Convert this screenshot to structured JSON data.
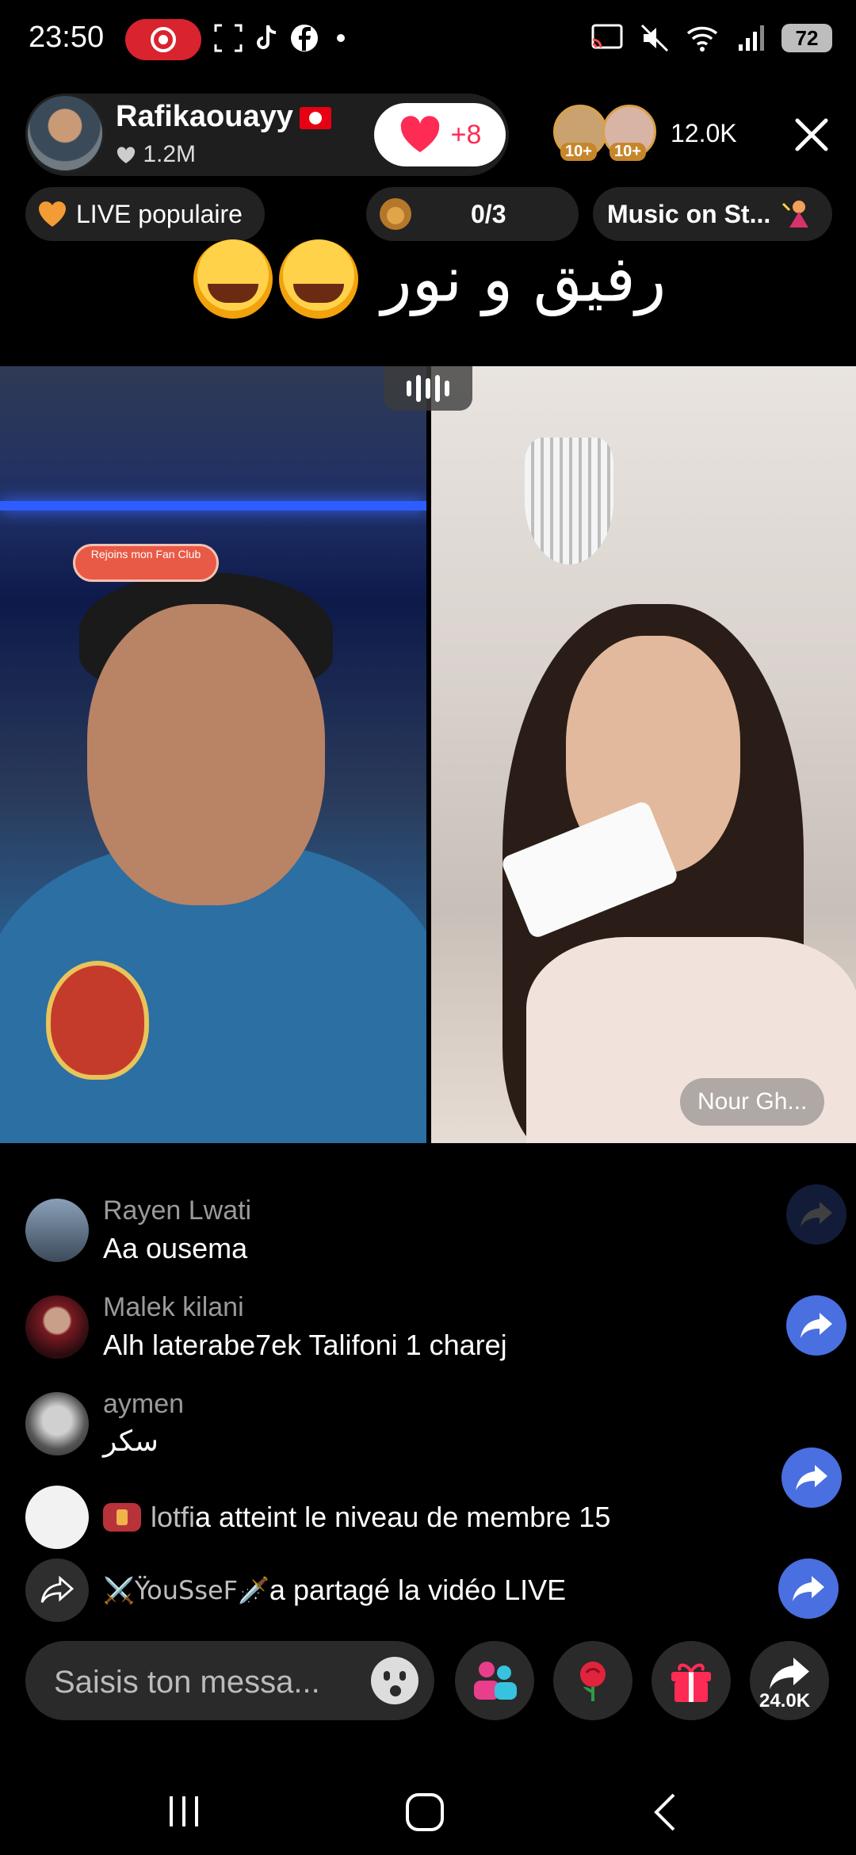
{
  "status_bar": {
    "time": "23:50",
    "battery": "72",
    "icons": [
      "screen-record-icon",
      "screenshot-icon",
      "tiktok-icon",
      "facebook-icon",
      "notification-dot-icon",
      "cast-icon",
      "mute-icon",
      "wifi-icon",
      "signal-icon",
      "battery-icon"
    ]
  },
  "host": {
    "name": "Rafikaouayy",
    "likes": "1.2M",
    "follow_count": "+8"
  },
  "viewers": {
    "badges": [
      "10+",
      "10+"
    ],
    "count": "12.0K"
  },
  "pills": {
    "popular": "LIVE populaire",
    "goal": "0/3",
    "music": "Music on St..."
  },
  "live_title": "رفيق و نور",
  "guest_name": "Nour Gh...",
  "fan_club_sticker": "Rejoins mon Fan Club",
  "comments": [
    {
      "user": "Rayen Lwati",
      "text": "Aa ousema"
    },
    {
      "user": "Malek kilani",
      "text": "Alh laterabe7ek Talifoni 1 charej"
    },
    {
      "user": "aymen",
      "text": "سكر"
    }
  ],
  "system_messages": {
    "level_user": "lotfi",
    "level_text": " a atteint le niveau de membre 15",
    "share_user": "⚔️ŸouSseF🗡️",
    "share_text": " a partagé la vidéo LIVE"
  },
  "bottom_bar": {
    "message_placeholder": "Saisis ton messa...",
    "share_count": "24.0K"
  },
  "colors": {
    "accent": "#fe2c55",
    "share_blue": "#4a6fe0",
    "record_red": "#d9232e"
  }
}
